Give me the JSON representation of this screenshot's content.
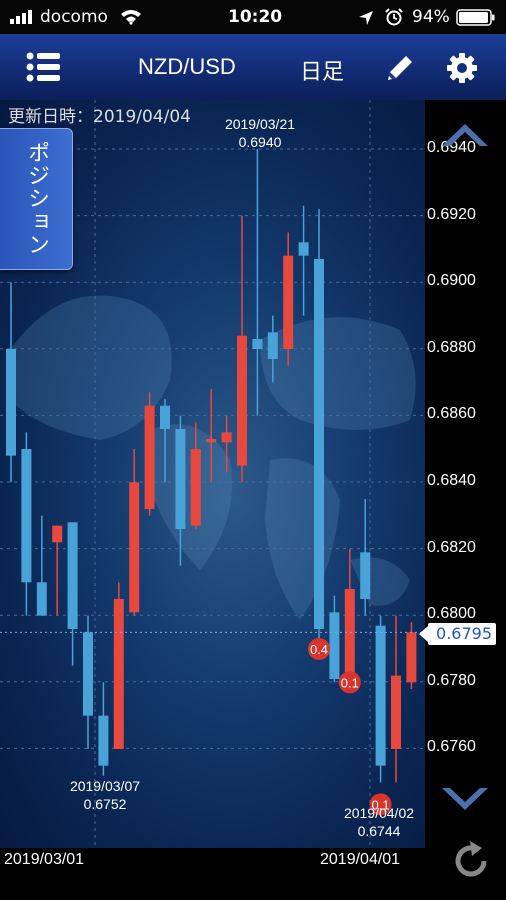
{
  "status_bar": {
    "carrier": "docomo",
    "time": "10:20",
    "battery": "94%"
  },
  "nav": {
    "pair": "NZD/USD",
    "timeframe": "日足"
  },
  "updated_label": "更新日時：2019/04/04",
  "position_tab": "ポジション",
  "current_price": "0.6795",
  "y_axis": {
    "ticks": [
      "0.6940",
      "0.6920",
      "0.6900",
      "0.6880",
      "0.6860",
      "0.6840",
      "0.6820",
      "0.6800",
      "0.6780",
      "0.6760"
    ]
  },
  "x_axis": {
    "labels": [
      "2019/03/01",
      "2019/04/01"
    ]
  },
  "annotations": {
    "high": {
      "date": "2019/03/21",
      "value": "0.6940"
    },
    "low1": {
      "date": "2019/03/07",
      "value": "0.6752"
    },
    "low2": {
      "date": "2019/04/02",
      "value": "0.6744"
    }
  },
  "markers": [
    "0.4",
    "0.1",
    "0.1"
  ],
  "colors": {
    "up": "#e8493f",
    "down": "#4aa3d8",
    "marker": "#d8342c"
  },
  "chart_data": {
    "type": "candlestick",
    "ylim": [
      0.674,
      0.695
    ],
    "candles": [
      {
        "o": 0.688,
        "h": 0.69,
        "l": 0.684,
        "c": 0.6848
      },
      {
        "o": 0.685,
        "h": 0.6855,
        "l": 0.68,
        "c": 0.681
      },
      {
        "o": 0.681,
        "h": 0.683,
        "l": 0.68,
        "c": 0.68
      },
      {
        "o": 0.6822,
        "h": 0.6827,
        "l": 0.68,
        "c": 0.6827
      },
      {
        "o": 0.6828,
        "h": 0.6828,
        "l": 0.6785,
        "c": 0.6796
      },
      {
        "o": 0.6795,
        "h": 0.68,
        "l": 0.676,
        "c": 0.677
      },
      {
        "o": 0.677,
        "h": 0.678,
        "l": 0.6752,
        "c": 0.6755
      },
      {
        "o": 0.676,
        "h": 0.681,
        "l": 0.676,
        "c": 0.6805
      },
      {
        "o": 0.6801,
        "h": 0.685,
        "l": 0.68,
        "c": 0.684
      },
      {
        "o": 0.6832,
        "h": 0.6867,
        "l": 0.683,
        "c": 0.6863
      },
      {
        "o": 0.6863,
        "h": 0.6865,
        "l": 0.684,
        "c": 0.6856
      },
      {
        "o": 0.6856,
        "h": 0.686,
        "l": 0.6815,
        "c": 0.6826
      },
      {
        "o": 0.6827,
        "h": 0.6858,
        "l": 0.6826,
        "c": 0.685
      },
      {
        "o": 0.6852,
        "h": 0.6868,
        "l": 0.684,
        "c": 0.6853
      },
      {
        "o": 0.6852,
        "h": 0.686,
        "l": 0.6843,
        "c": 0.6855
      },
      {
        "o": 0.6845,
        "h": 0.692,
        "l": 0.684,
        "c": 0.6884
      },
      {
        "o": 0.6883,
        "h": 0.694,
        "l": 0.686,
        "c": 0.688
      },
      {
        "o": 0.6885,
        "h": 0.689,
        "l": 0.687,
        "c": 0.6877
      },
      {
        "o": 0.688,
        "h": 0.6915,
        "l": 0.6875,
        "c": 0.6908
      },
      {
        "o": 0.6912,
        "h": 0.6923,
        "l": 0.689,
        "c": 0.6908
      },
      {
        "o": 0.6907,
        "h": 0.6922,
        "l": 0.679,
        "c": 0.6796
      },
      {
        "o": 0.6801,
        "h": 0.6806,
        "l": 0.678,
        "c": 0.6781
      },
      {
        "o": 0.678,
        "h": 0.682,
        "l": 0.678,
        "c": 0.6808
      },
      {
        "o": 0.6819,
        "h": 0.6835,
        "l": 0.68,
        "c": 0.6805
      },
      {
        "o": 0.6797,
        "h": 0.68,
        "l": 0.675,
        "c": 0.6755
      },
      {
        "o": 0.676,
        "h": 0.68,
        "l": 0.675,
        "c": 0.6782
      },
      {
        "o": 0.678,
        "h": 0.6798,
        "l": 0.6778,
        "c": 0.6795
      }
    ]
  }
}
